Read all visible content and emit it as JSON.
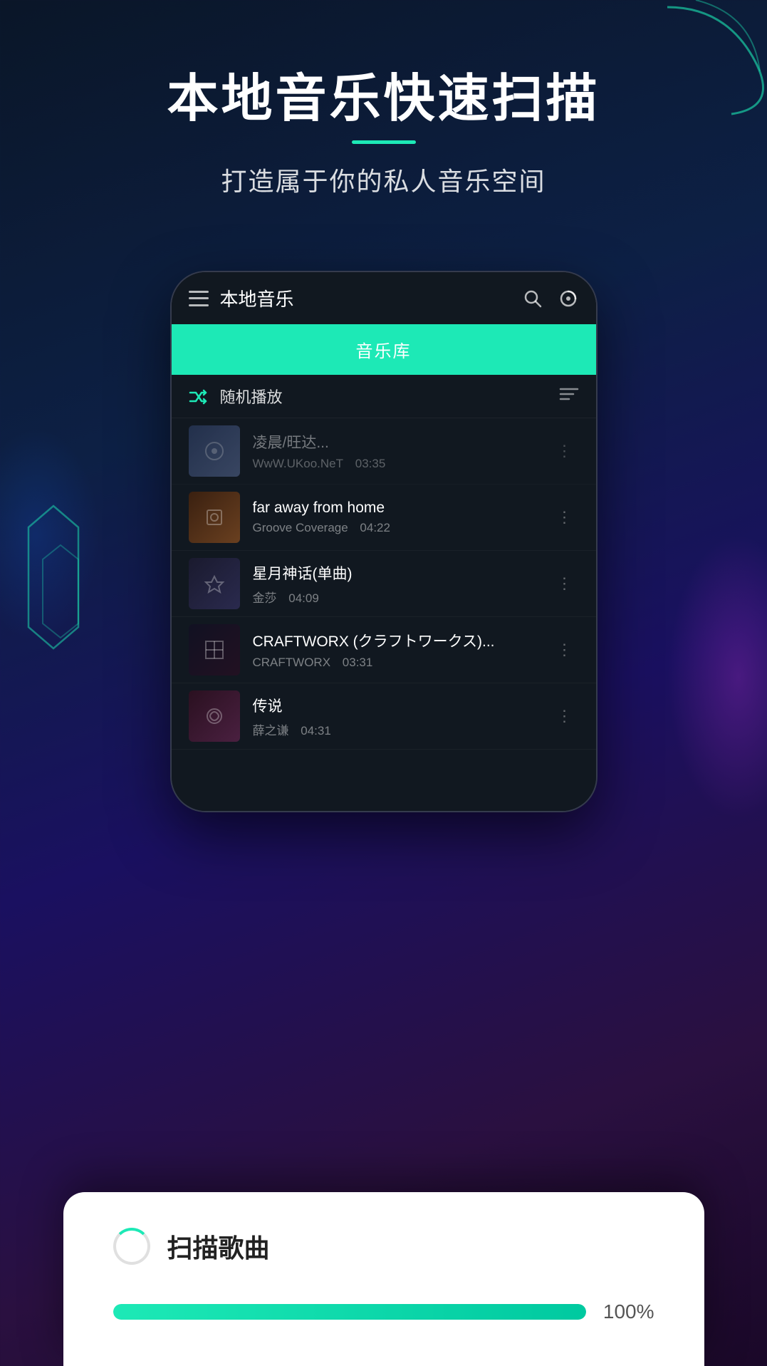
{
  "page": {
    "background": "#0a1628"
  },
  "header": {
    "main_title": "本地音乐快速扫描",
    "sub_title": "打造属于你的私人音乐空间"
  },
  "phone": {
    "topbar_title": "本地音乐",
    "music_lib_tab": "音乐库",
    "shuffle_label": "随机播放"
  },
  "songs": [
    {
      "title": "凌晨/旺达...",
      "artist": "WwW.UKoo.NeT",
      "duration": "03:35",
      "art_class": "art-1"
    },
    {
      "title": "far away from home",
      "artist": "Groove Coverage",
      "duration": "04:22",
      "art_class": "art-2"
    },
    {
      "title": "星月神话(单曲)",
      "artist": "金莎",
      "duration": "04:09",
      "art_class": "art-3"
    },
    {
      "title": "CRAFTWORX (クラフトワークス)...",
      "artist": "CRAFTWORX",
      "duration": "03:31",
      "art_class": "art-4"
    },
    {
      "title": "传说",
      "artist": "薛之谦",
      "duration": "04:31",
      "art_class": "art-5"
    }
  ],
  "scan_dialog": {
    "title": "扫描歌曲",
    "progress_percent": "100%",
    "progress_value": 100
  }
}
